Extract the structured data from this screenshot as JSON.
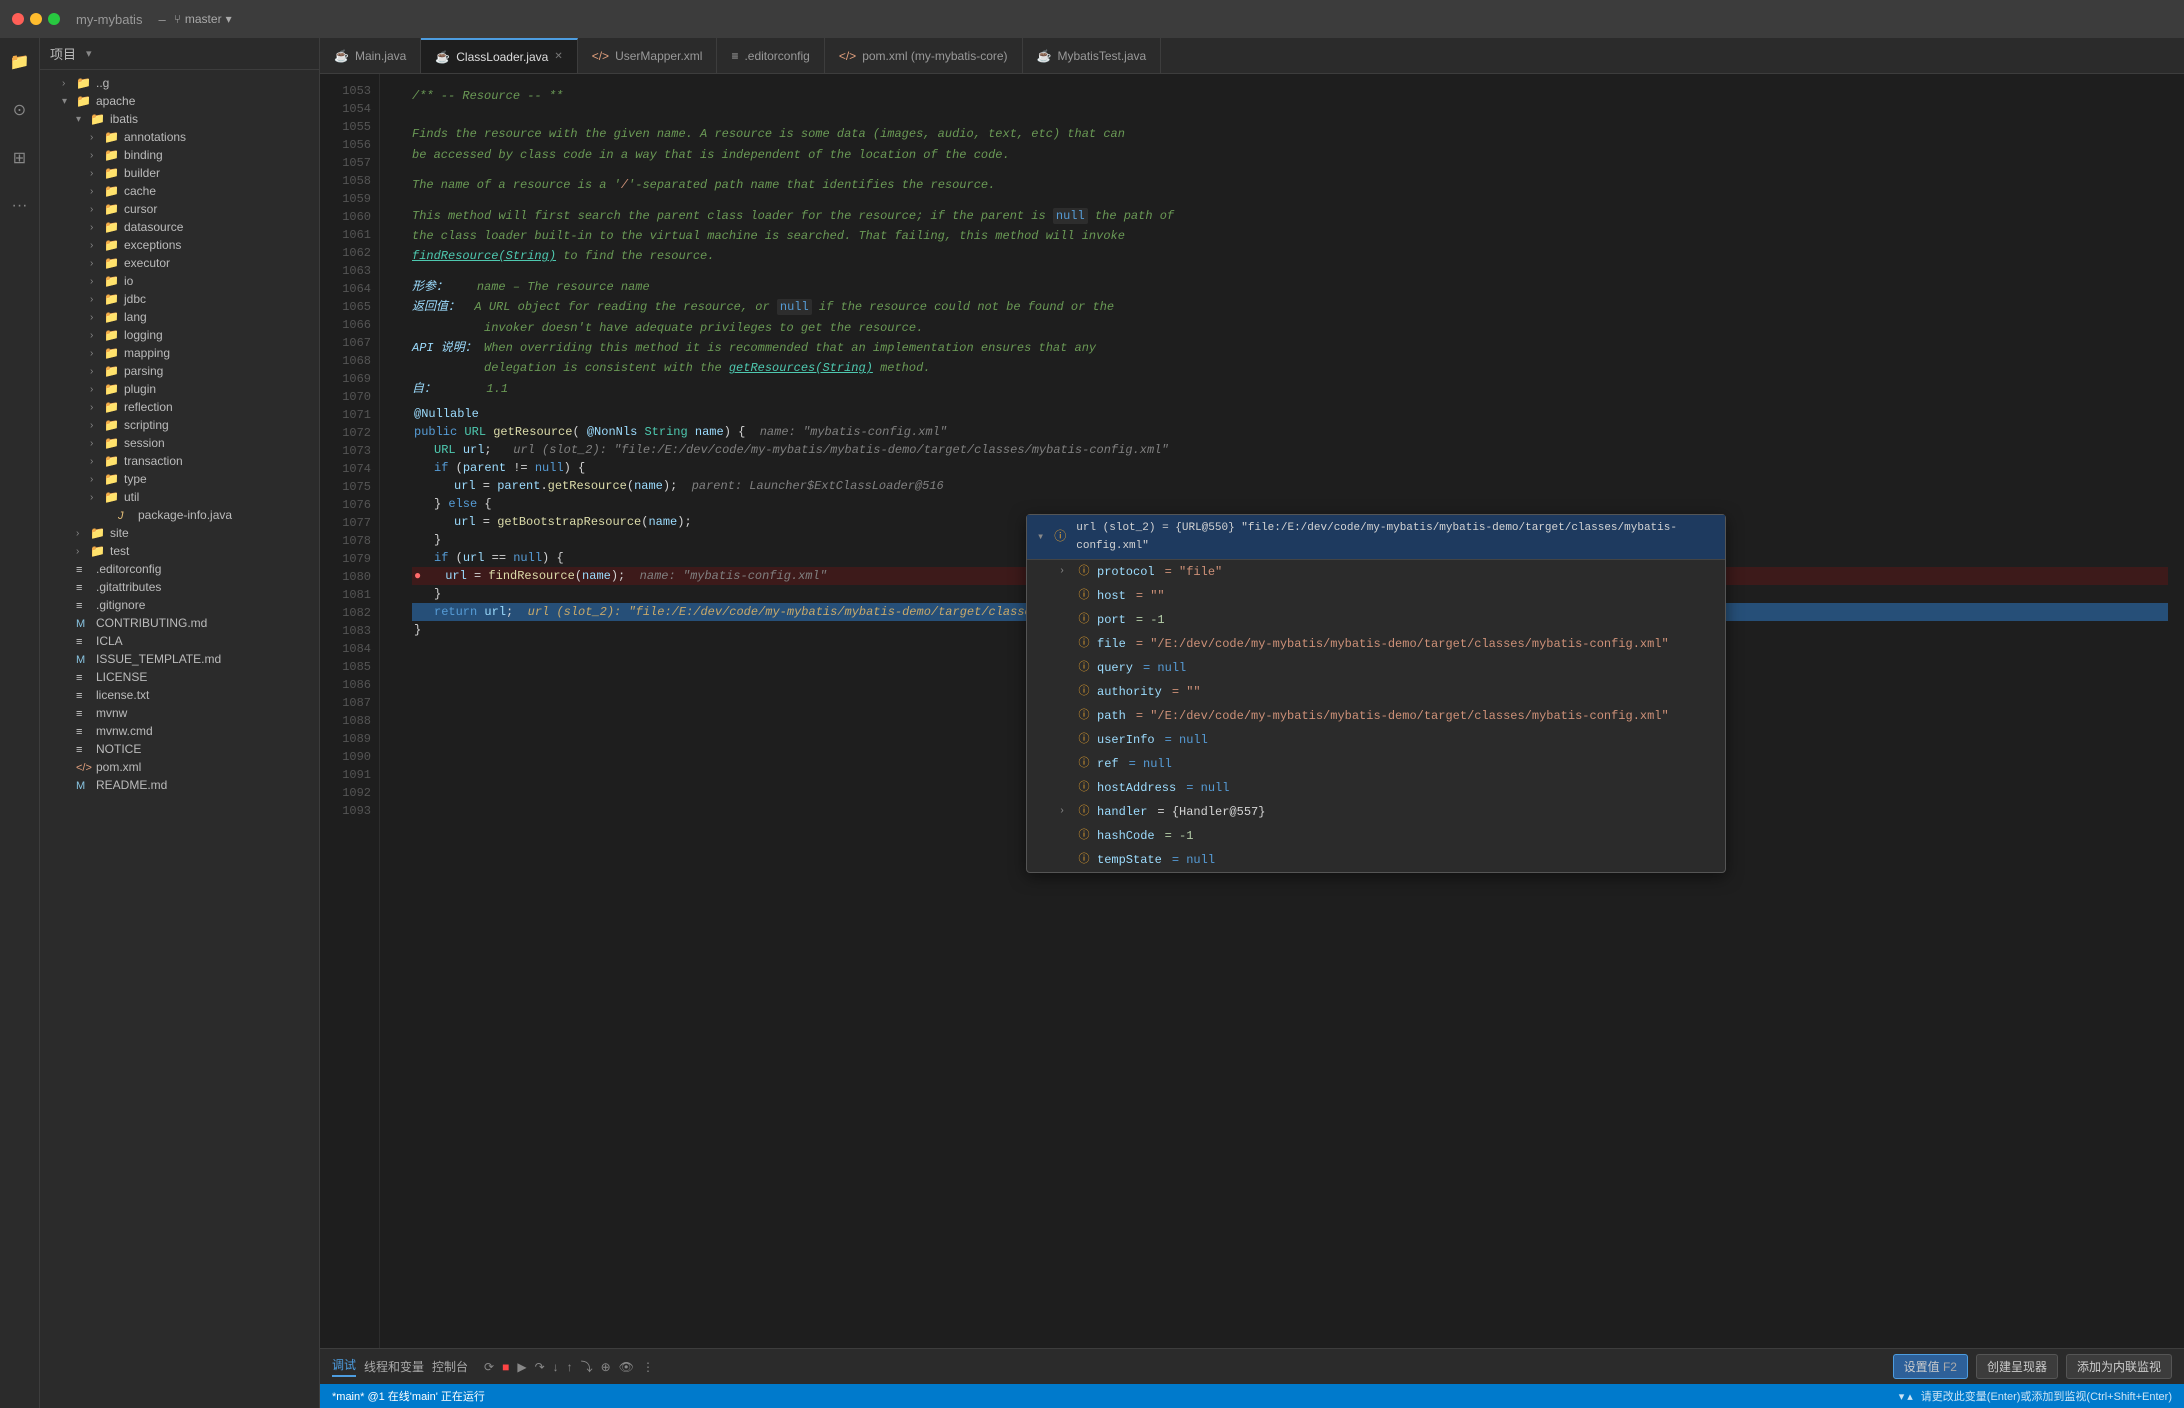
{
  "titleBar": {
    "project": "my-mybatis",
    "branch": "master",
    "branchIcon": "⑂"
  },
  "sidebar": {
    "title": "项目",
    "tree": [
      {
        "id": "t1",
        "label": "..g",
        "indent": 1,
        "type": "folder",
        "expanded": false
      },
      {
        "id": "t2",
        "label": "apache",
        "indent": 1,
        "type": "folder",
        "expanded": true
      },
      {
        "id": "t3",
        "label": "ibatis",
        "indent": 2,
        "type": "folder",
        "expanded": true
      },
      {
        "id": "t4",
        "label": "annotations",
        "indent": 3,
        "type": "folder",
        "expanded": false
      },
      {
        "id": "t5",
        "label": "binding",
        "indent": 3,
        "type": "folder",
        "expanded": false
      },
      {
        "id": "t6",
        "label": "builder",
        "indent": 3,
        "type": "folder",
        "expanded": false
      },
      {
        "id": "t7",
        "label": "cache",
        "indent": 3,
        "type": "folder",
        "expanded": false
      },
      {
        "id": "t8",
        "label": "cursor",
        "indent": 3,
        "type": "folder",
        "expanded": false
      },
      {
        "id": "t9",
        "label": "datasource",
        "indent": 3,
        "type": "folder",
        "expanded": false
      },
      {
        "id": "t10",
        "label": "exceptions",
        "indent": 3,
        "type": "folder",
        "expanded": false
      },
      {
        "id": "t11",
        "label": "executor",
        "indent": 3,
        "type": "folder",
        "expanded": false
      },
      {
        "id": "t12",
        "label": "io",
        "indent": 3,
        "type": "folder",
        "expanded": false
      },
      {
        "id": "t13",
        "label": "jdbc",
        "indent": 3,
        "type": "folder",
        "expanded": false
      },
      {
        "id": "t14",
        "label": "lang",
        "indent": 3,
        "type": "folder",
        "expanded": false
      },
      {
        "id": "t15",
        "label": "logging",
        "indent": 3,
        "type": "folder",
        "expanded": false
      },
      {
        "id": "t16",
        "label": "mapping",
        "indent": 3,
        "type": "folder",
        "expanded": false
      },
      {
        "id": "t17",
        "label": "parsing",
        "indent": 3,
        "type": "folder",
        "expanded": false
      },
      {
        "id": "t18",
        "label": "plugin",
        "indent": 3,
        "type": "folder",
        "expanded": false
      },
      {
        "id": "t19",
        "label": "reflection",
        "indent": 3,
        "type": "folder",
        "expanded": false
      },
      {
        "id": "t20",
        "label": "scripting",
        "indent": 3,
        "type": "folder",
        "expanded": false
      },
      {
        "id": "t21",
        "label": "session",
        "indent": 3,
        "type": "folder",
        "expanded": false
      },
      {
        "id": "t22",
        "label": "transaction",
        "indent": 3,
        "type": "folder",
        "expanded": false
      },
      {
        "id": "t23",
        "label": "type",
        "indent": 3,
        "type": "folder",
        "expanded": false
      },
      {
        "id": "t24",
        "label": "util",
        "indent": 3,
        "type": "folder",
        "expanded": false
      },
      {
        "id": "t25",
        "label": "package-info.java",
        "indent": 4,
        "type": "java",
        "expanded": false
      },
      {
        "id": "t26",
        "label": "site",
        "indent": 2,
        "type": "folder",
        "expanded": false
      },
      {
        "id": "t27",
        "label": "test",
        "indent": 2,
        "type": "folder",
        "expanded": false
      },
      {
        "id": "t28",
        "label": ".editorconfig",
        "indent": 1,
        "type": "file",
        "expanded": false
      },
      {
        "id": "t29",
        "label": ".gitattributes",
        "indent": 1,
        "type": "file",
        "expanded": false
      },
      {
        "id": "t30",
        "label": ".gitignore",
        "indent": 1,
        "type": "file",
        "expanded": false
      },
      {
        "id": "t31",
        "label": "CONTRIBUTING.md",
        "indent": 1,
        "type": "md",
        "expanded": false
      },
      {
        "id": "t32",
        "label": "ICLA",
        "indent": 1,
        "type": "file",
        "expanded": false
      },
      {
        "id": "t33",
        "label": "ISSUE_TEMPLATE.md",
        "indent": 1,
        "type": "md",
        "expanded": false
      },
      {
        "id": "t34",
        "label": "LICENSE",
        "indent": 1,
        "type": "file",
        "expanded": false
      },
      {
        "id": "t35",
        "label": "license.txt",
        "indent": 1,
        "type": "file",
        "expanded": false
      },
      {
        "id": "t36",
        "label": "mvnw",
        "indent": 1,
        "type": "file",
        "expanded": false
      },
      {
        "id": "t37",
        "label": "mvnw.cmd",
        "indent": 1,
        "type": "file",
        "expanded": false
      },
      {
        "id": "t38",
        "label": "NOTICE",
        "indent": 1,
        "type": "file",
        "expanded": false
      },
      {
        "id": "t39",
        "label": "pom.xml",
        "indent": 1,
        "type": "xml",
        "expanded": false
      },
      {
        "id": "t40",
        "label": "README.md",
        "indent": 1,
        "type": "md",
        "expanded": false
      }
    ]
  },
  "tabs": [
    {
      "id": "tab1",
      "label": "Main.java",
      "type": "java",
      "active": false
    },
    {
      "id": "tab2",
      "label": "ClassLoader.java",
      "type": "java",
      "active": true,
      "closeable": true
    },
    {
      "id": "tab3",
      "label": "UserMapper.xml",
      "type": "xml",
      "active": false
    },
    {
      "id": "tab4",
      "label": ".editorconfig",
      "type": "config",
      "active": false
    },
    {
      "id": "tab5",
      "label": "pom.xml (my-mybatis-core)",
      "type": "xml",
      "active": false
    },
    {
      "id": "tab6",
      "label": "MybatisTest.java",
      "type": "java",
      "active": false
    }
  ],
  "lineNumbers": [
    1053,
    1054,
    1055,
    1056,
    1057,
    1058,
    1059,
    1060,
    1061,
    1062,
    1063,
    1064,
    1065,
    1066,
    1067,
    1068,
    1069,
    1070,
    1071,
    1072,
    1073,
    1074,
    1075,
    1076,
    1077,
    1078,
    1079,
    1080,
    1081,
    1082,
    1083,
    1084,
    1085,
    1086,
    1087,
    1088,
    1089,
    1090,
    1091,
    1092,
    1093
  ],
  "docComment": {
    "header": "/** -- Resource -- **",
    "body1": "Finds the resource with the given name. A resource is some data (images, audio, text, etc) that can",
    "body2": "be accessed by class code in a way that is independent of the location of the code.",
    "body3": "The name of a resource is a '/'-separated path name that identifies the resource.",
    "body4": "This method will first search the parent class loader for the resource; if the parent is",
    "body4_null": "null",
    "body4b": "the path of",
    "body5": "the class loader built-in to the virtual machine is searched. That failing, this method will invoke",
    "body6_link": "findResource(String)",
    "body6b": "to find the resource.",
    "param_label": "形参：",
    "param_val": "name – The resource name",
    "return_label": "返回值：",
    "return_val": "A URL object for reading the resource, or",
    "return_null": "null",
    "return_val2": "if the resource could not be found or the",
    "return_val3": "invoker doesn't have adequate privileges to get the resource.",
    "api_label": "API 说明：",
    "api_val": "When overriding this method it is recommended that an implementation ensures that any",
    "api_val2": "delegation is consistent with the",
    "api_link": "getResources(String)",
    "api_val3": "method.",
    "since_label": "自：",
    "since_val": "1.1"
  },
  "codeLines": {
    "nullable": "@Nullable",
    "signature": "public URL getResource( @NonNls String name) {",
    "hint_name": "name: \"mybatis-config.xml\"",
    "l1082": "    URL url;",
    "hint_url": "url (slot_2): \"file:/E:/dev/code/my-mybatis/mybatis-demo/target/classes/mybatis-config.xml\"",
    "l1083": "    if (parent != null) {",
    "l1084": "        url = parent.getResource(name);",
    "hint_parent": "parent: Launcher$ExtClassLoader@516",
    "l1085": "    } else {",
    "l1086": "        url = getBootstrapResource(name);",
    "l1087": "    }",
    "l1088": "    if (url == null) {",
    "l1089_indent": "        url = findResource(name);",
    "hint_find": "name: \"mybatis-config.xml\"",
    "l1090": "    }",
    "l1091": "    return url;",
    "hint_return": "url (slot_2): \"file:/E:/dev/code/my-mybatis/mybatis-demo/target/classes/mybatis-config.xml\"",
    "l1092": "}",
    "l1093": ""
  },
  "debugTooltip": {
    "headerText": "url (slot_2) = {URL@550} \"file:/E:/dev/code/my-mybatis/mybatis-demo/target/classes/mybatis-config.xml\"",
    "fields": [
      {
        "key": "protocol",
        "val": "= \"file\"",
        "expandable": true,
        "type": "string"
      },
      {
        "key": "host",
        "val": "= \"\"",
        "expandable": false,
        "type": "string"
      },
      {
        "key": "port",
        "val": "= -1",
        "expandable": false,
        "type": "number"
      },
      {
        "key": "file",
        "val": "= \"/E:/dev/code/my-mybatis/mybatis-demo/target/classes/mybatis-config.xml\"",
        "expandable": false,
        "type": "path"
      },
      {
        "key": "query",
        "val": "= null",
        "expandable": false,
        "type": "null"
      },
      {
        "key": "authority",
        "val": "= \"\"",
        "expandable": false,
        "type": "string"
      },
      {
        "key": "path",
        "val": "= \"/E:/dev/code/my-mybatis/mybatis-demo/target/classes/mybatis-config.xml\"",
        "expandable": false,
        "type": "path"
      },
      {
        "key": "userInfo",
        "val": "= null",
        "expandable": false,
        "type": "null"
      },
      {
        "key": "ref",
        "val": "= null",
        "expandable": false,
        "type": "null"
      },
      {
        "key": "hostAddress",
        "val": "= null",
        "expandable": false,
        "type": "null"
      },
      {
        "key": "handler",
        "val": "= {Handler@557}",
        "expandable": true,
        "type": "object"
      },
      {
        "key": "hashCode",
        "val": "= -1",
        "expandable": false,
        "type": "number"
      },
      {
        "key": "tempState",
        "val": "= null",
        "expandable": false,
        "type": "null"
      }
    ]
  },
  "bottomBar": {
    "debugLabel": "调试",
    "frameLabel": "线程和变量",
    "consoleLabel": "控制台",
    "btn1": "设置值",
    "btn1_shortcut": "F2",
    "btn2": "创建呈现器",
    "btn3": "添加为内联监视"
  },
  "statusBar": {
    "left": "*main* @1 在线'main' 正在运行",
    "right": "请更改此变量(Enter)或添加到监视(Ctrl+Shift+Enter)"
  }
}
